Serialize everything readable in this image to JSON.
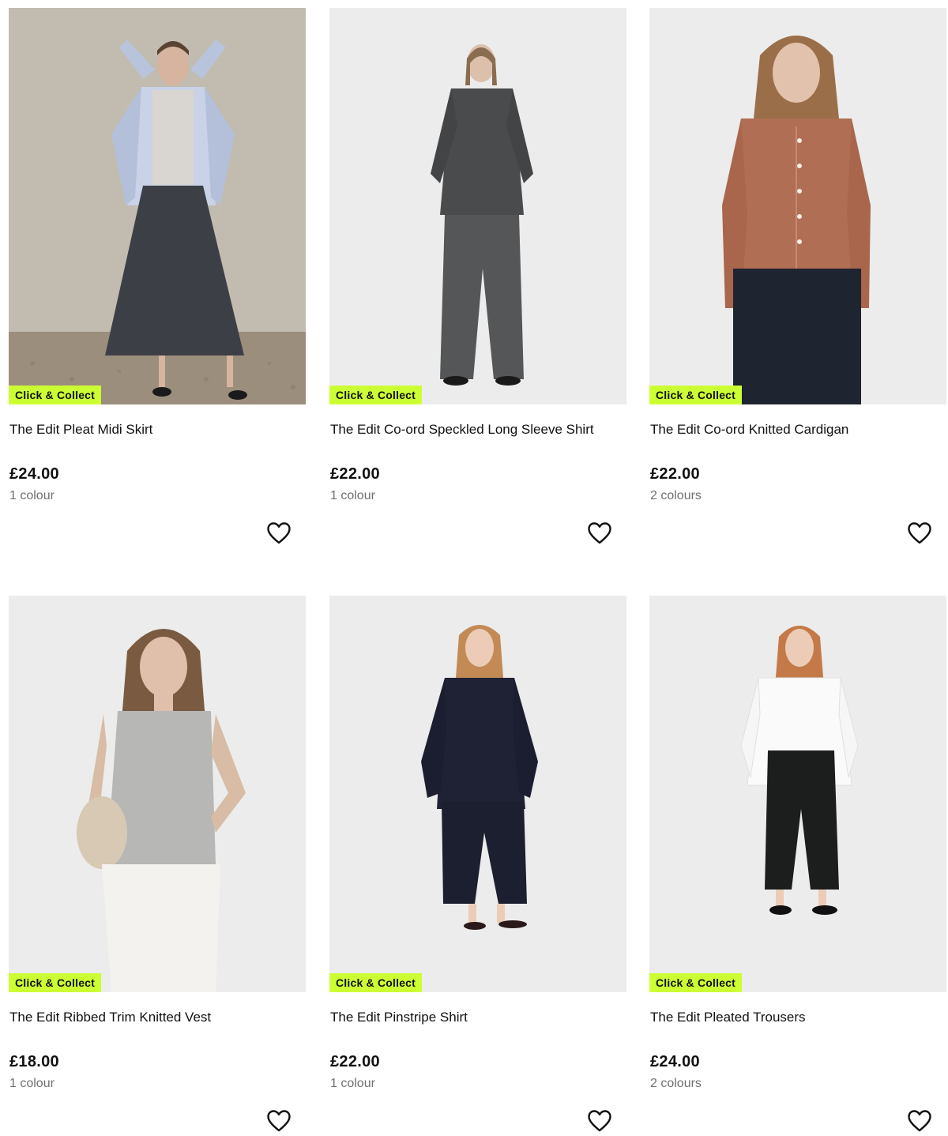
{
  "colors": {
    "badge_bg": "#ccff33",
    "text": "#111111",
    "muted": "#707070"
  },
  "products": [
    {
      "title": "The Edit Pleat Midi Skirt",
      "price": "£24.00",
      "colours": "1 colour",
      "badge": "Click & Collect",
      "image": "model-pleat-midi-skirt",
      "wishlist_icon": "heart-outline-icon"
    },
    {
      "title": "The Edit Co-ord Speckled Long Sleeve Shirt",
      "price": "£22.00",
      "colours": "1 colour",
      "badge": "Click & Collect",
      "image": "model-speckled-shirt",
      "wishlist_icon": "heart-outline-icon"
    },
    {
      "title": "The Edit Co-ord Knitted Cardigan",
      "price": "£22.00",
      "colours": "2 colours",
      "badge": "Click & Collect",
      "image": "model-knitted-cardigan",
      "wishlist_icon": "heart-outline-icon"
    },
    {
      "title": "The Edit Ribbed Trim Knitted Vest",
      "price": "£18.00",
      "colours": "1 colour",
      "badge": "Click & Collect",
      "image": "model-knitted-vest",
      "wishlist_icon": "heart-outline-icon"
    },
    {
      "title": "The Edit Pinstripe Shirt",
      "price": "£22.00",
      "colours": "1 colour",
      "badge": "Click & Collect",
      "image": "model-pinstripe-shirt",
      "wishlist_icon": "heart-outline-icon"
    },
    {
      "title": "The Edit Pleated Trousers",
      "price": "£24.00",
      "colours": "2 colours",
      "badge": "Click & Collect",
      "image": "model-pleated-trousers",
      "wishlist_icon": "heart-outline-icon"
    }
  ]
}
